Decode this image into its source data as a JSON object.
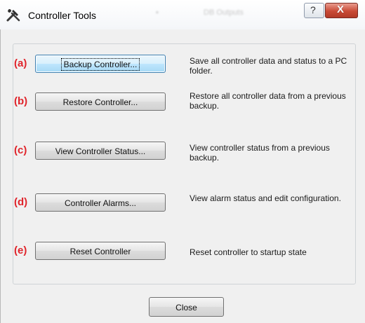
{
  "window": {
    "title": "Controller Tools",
    "ghost_title_fragments": [
      "DB Outputs"
    ]
  },
  "titlebar": {
    "help_glyph": "?",
    "close_glyph": "X"
  },
  "rows": [
    {
      "marker": "(a)",
      "button_label": "Backup Controller...",
      "description": "Save all controller data and status to a PC folder.",
      "focused": true
    },
    {
      "marker": "(b)",
      "button_label": "Restore Controller...",
      "description": "Restore all controller data from a previous backup.",
      "focused": false
    },
    {
      "marker": "(c)",
      "button_label": "View Controller Status...",
      "description": "View controller status from a previous backup.",
      "focused": false
    },
    {
      "marker": "(d)",
      "button_label": "Controller Alarms...",
      "description": "View alarm status and edit configuration.",
      "focused": false
    },
    {
      "marker": "(e)",
      "button_label": "Reset Controller",
      "description": "Reset controller to startup state",
      "focused": false
    }
  ],
  "footer": {
    "close_label": "Close"
  },
  "colors": {
    "marker": "#e0242b",
    "focus_border": "#3c7fb1",
    "close_button_red": "#c94a36"
  },
  "icons": {
    "app": "tools-icon",
    "help": "question-icon",
    "close": "close-icon"
  }
}
